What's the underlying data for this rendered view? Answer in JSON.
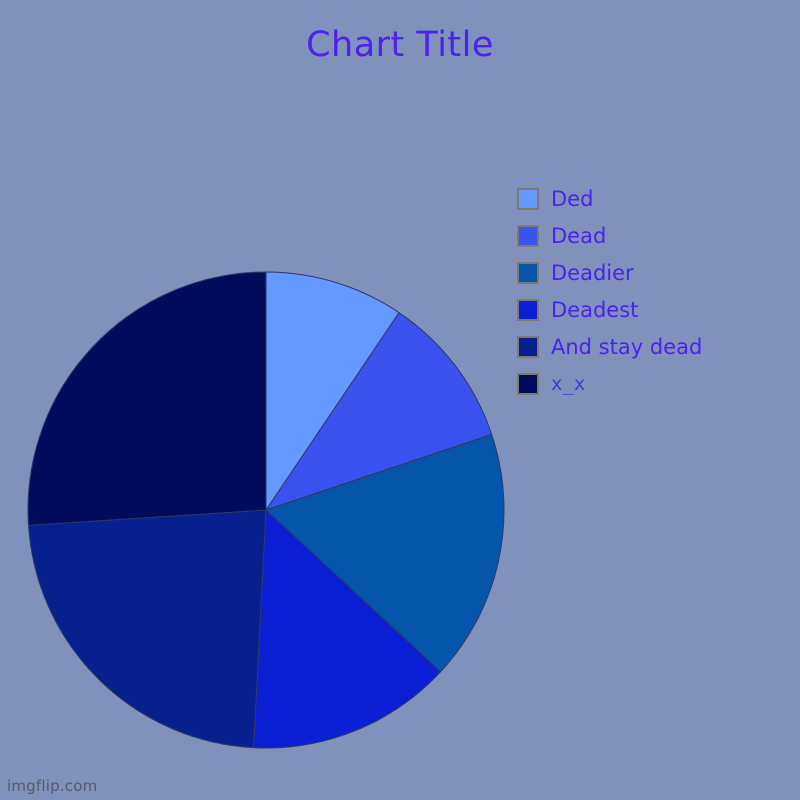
{
  "page": {
    "background_color": "#8091bc",
    "watermark": "imgflip.com",
    "watermark_color": "#555a66"
  },
  "header": {
    "title": "Chart Title",
    "title_color": "#4b22ee"
  },
  "legend": {
    "position": "right",
    "items": [
      {
        "label": "Ded",
        "color": "#6699ff"
      },
      {
        "label": "Dead",
        "color": "#3a52ee"
      },
      {
        "label": "Deadier",
        "color": "#0556aa"
      },
      {
        "label": "Deadest",
        "color": "#0a1fd4"
      },
      {
        "label": "And stay dead",
        "color": "#06218e"
      },
      {
        "label": "x_x",
        "color": "#000b5c"
      }
    ]
  },
  "chart_data": {
    "type": "pie",
    "title": "Chart Title",
    "xlabel": "",
    "ylabel": "",
    "legend_position": "right",
    "grid": false,
    "start_angle_deg": 0,
    "direction": "clockwise",
    "categories": [
      "Ded",
      "Dead",
      "Deadier",
      "Deadest",
      "And stay dead",
      "x_x"
    ],
    "colors": [
      "#6699ff",
      "#3a52ee",
      "#0556aa",
      "#0a1fd4",
      "#06218e",
      "#000b5c"
    ],
    "values": [
      9.4,
      10.4,
      17.0,
      14.0,
      23.1,
      26.1
    ],
    "angles_deg": [
      34.0,
      37.5,
      61.3,
      50.2,
      83.3,
      93.7
    ],
    "slices": [
      {
        "label": "Ded",
        "color": "#6699ff",
        "value": 9.4,
        "angle_deg": 34.0,
        "start_deg": 0.0,
        "end_deg": 34.0
      },
      {
        "label": "Dead",
        "color": "#3a52ee",
        "value": 10.4,
        "angle_deg": 37.5,
        "start_deg": 34.0,
        "end_deg": 71.5
      },
      {
        "label": "Deadier",
        "color": "#0556aa",
        "value": 17.0,
        "angle_deg": 61.3,
        "start_deg": 71.5,
        "end_deg": 132.8
      },
      {
        "label": "Deadest",
        "color": "#0a1fd4",
        "value": 14.0,
        "angle_deg": 50.2,
        "start_deg": 132.8,
        "end_deg": 183.0
      },
      {
        "label": "And stay dead",
        "color": "#06218e",
        "value": 23.1,
        "angle_deg": 83.3,
        "start_deg": 183.0,
        "end_deg": 266.3
      },
      {
        "label": "x_x",
        "color": "#000b5c",
        "value": 26.1,
        "angle_deg": 93.7,
        "start_deg": 266.3,
        "end_deg": 360.0
      }
    ]
  }
}
